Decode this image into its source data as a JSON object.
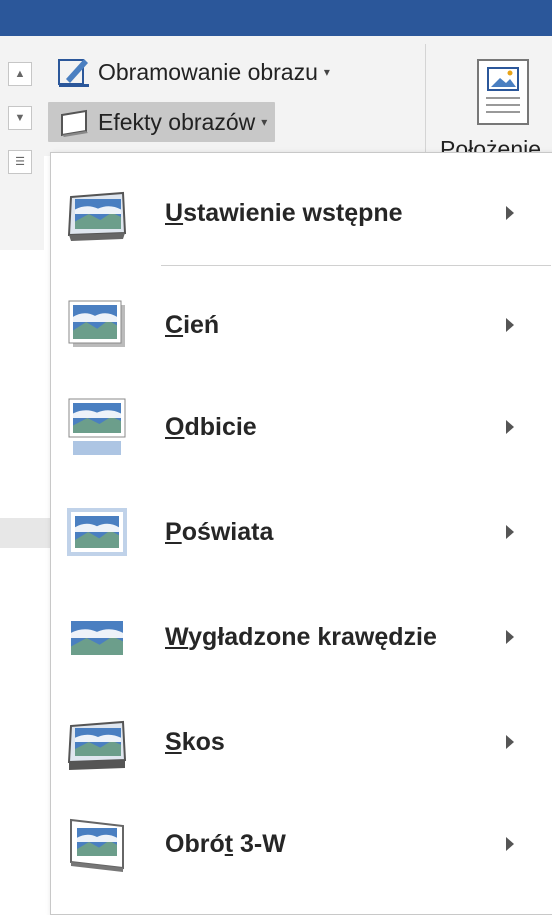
{
  "ribbon": {
    "border_button": "Obramowanie obrazu",
    "effects_button": "Efekty obrazów",
    "position_button": "Położenie"
  },
  "menu": {
    "items": [
      {
        "pre": "",
        "ul": "U",
        "post": "stawienie wstępne",
        "icon": "preset-picture-icon"
      },
      {
        "pre": "",
        "ul": "C",
        "post": "ień",
        "icon": "shadow-picture-icon"
      },
      {
        "pre": "",
        "ul": "O",
        "post": "dbicie",
        "icon": "reflection-picture-icon"
      },
      {
        "pre": "",
        "ul": "P",
        "post": "oświata",
        "icon": "glow-picture-icon"
      },
      {
        "pre": "",
        "ul": "W",
        "post": "ygładzone krawędzie",
        "icon": "soft-edges-picture-icon"
      },
      {
        "pre": "",
        "ul": "S",
        "post": "kos",
        "icon": "bevel-picture-icon"
      },
      {
        "pre": "Obró",
        "ul": "t",
        "post": " 3-W",
        "icon": "3d-rotation-picture-icon"
      }
    ]
  },
  "colors": {
    "title_bar": "#2b579a",
    "sky": "#4a7fc1",
    "hills": "#6c9e8b"
  }
}
